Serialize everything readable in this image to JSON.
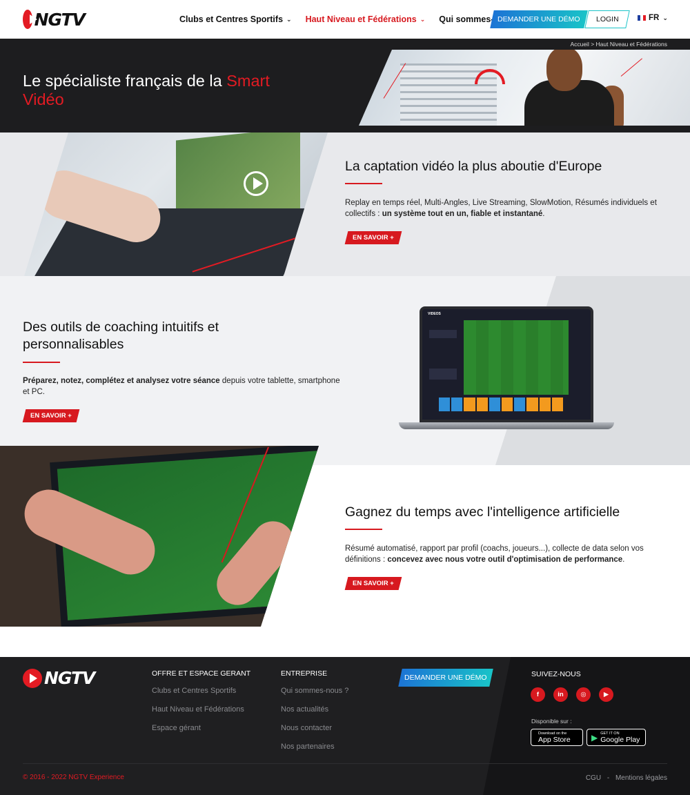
{
  "header": {
    "logo_text": "NGTV",
    "nav": [
      {
        "label": "Clubs et Centres Sportifs",
        "active": false
      },
      {
        "label": "Haut Niveau et Fédérations",
        "active": true
      },
      {
        "label": "Qui sommes-nous ?",
        "active": false
      }
    ],
    "demo_label": "DEMANDER UNE DÉMO",
    "login_label": "LOGIN",
    "lang_label": "FR"
  },
  "hero": {
    "breadcrumb": "Accueil > Haut Niveau et Fédérations",
    "title_plain": "Le spécialiste français de la ",
    "title_accent": "Smart Vidéo"
  },
  "section1": {
    "title": "La captation vidéo la plus aboutie d'Europe",
    "text_plain": "Replay en temps réel, Multi-Angles, Live Streaming, SlowMotion, Résumés individuels et collectifs : ",
    "text_bold": "un système tout en un, fiable et instantané",
    "text_end": ".",
    "button_label": "EN SAVOIR +"
  },
  "section2": {
    "title": "Des outils de coaching intuitifs et personnalisables",
    "text_bold": "Préparez, notez, complétez et analysez votre séance",
    "text_plain": " depuis votre tablette, smartphone et PC.",
    "button_label": "EN SAVOIR +",
    "screen_header": "VIDEOS"
  },
  "section3": {
    "title": "Gagnez du temps avec l'intelligence artificielle",
    "text_plain": "Résumé automatisé, rapport par profil (coachs, joueurs...), collecte de data selon vos définitions : ",
    "text_bold": "concevez avec nous votre outil d'optimisation de performance",
    "text_end": ".",
    "button_label": "EN SAVOIR +"
  },
  "footer": {
    "logo_text": "NGTV",
    "col1_title": "OFFRE ET ESPACE GERANT",
    "col1_links": [
      "Clubs et Centres Sportifs",
      "Haut Niveau et Fédérations",
      "Espace gérant"
    ],
    "col2_title": "ENTREPRISE",
    "col2_links": [
      "Qui sommes-nous ?",
      "Nos actualités",
      "Nous contacter",
      "Nos partenaires"
    ],
    "demo_label": "DEMANDER UNE DÉMO",
    "social_title": "SUIVEZ-NOUS",
    "available_label": "Disponible sur :",
    "appstore_small": "Download on the",
    "appstore_big": "App Store",
    "googleplay_small": "GET IT ON",
    "googleplay_big": "Google Play",
    "copyright": "© 2016 - 2022 NGTV Experience",
    "legal_cgu": "CGU",
    "legal_sep": "-",
    "legal_mentions": "Mentions légales"
  },
  "colors": {
    "brand_red": "#d7191f",
    "accent_gradient_start": "#1c74d5",
    "accent_gradient_end": "#19c3c8",
    "dark": "#1d1d1f"
  }
}
